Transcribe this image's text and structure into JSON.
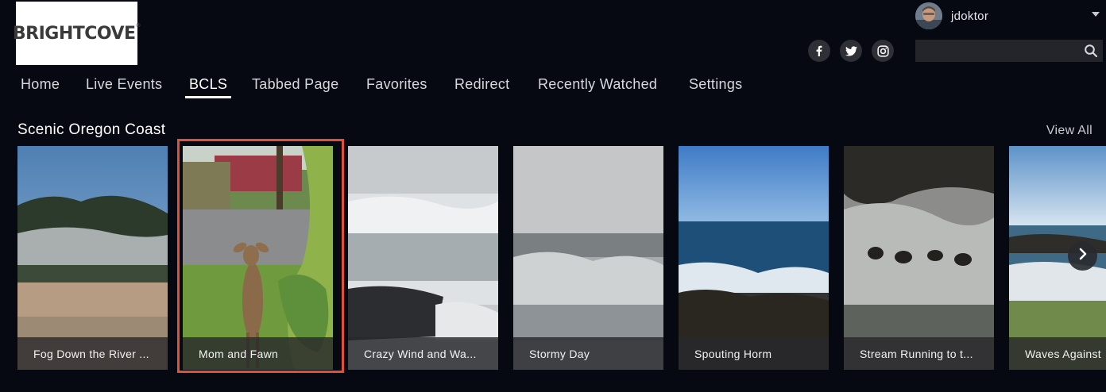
{
  "brand": {
    "logo_text": "BRIGHTCOVE",
    "logo_mark": "®"
  },
  "user": {
    "name": "jdoktor"
  },
  "social": [
    "facebook-icon",
    "twitter-icon",
    "instagram-icon"
  ],
  "search": {
    "placeholder": ""
  },
  "nav": {
    "items": [
      "Home",
      "Live Events",
      "BCLS",
      "Tabbed Page",
      "Favorites",
      "Redirect",
      "Recently Watched",
      "Settings"
    ],
    "active": "BCLS"
  },
  "row": {
    "title": "Scenic Oregon Coast",
    "view_all": "View All",
    "videos": [
      {
        "title": "Fog Down the River ..."
      },
      {
        "title": "Mom and Fawn"
      },
      {
        "title": "Crazy Wind and Wa..."
      },
      {
        "title": "Stormy Day"
      },
      {
        "title": "Spouting Horm"
      },
      {
        "title": "Stream Running to t..."
      },
      {
        "title": "Waves Against"
      }
    ],
    "selected_index": 1
  },
  "colors": {
    "background": "#060912",
    "selection": "#e0503c",
    "accent_text": "#ffffff"
  }
}
